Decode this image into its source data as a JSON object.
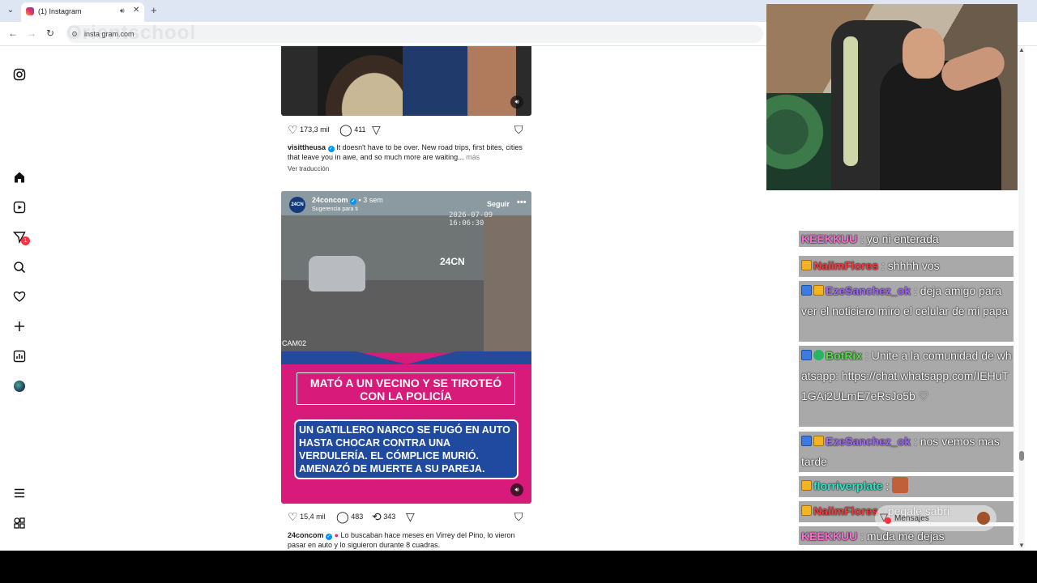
{
  "browser": {
    "tab_title": "(1) Instagram",
    "tab_dropdown_icon": "chevron-down-icon",
    "audio_icon": "speaker-icon",
    "close_icon": "close-icon",
    "new_tab_icon": "plus-icon",
    "back_icon": "arrow-left-icon",
    "forward_icon": "arrow-right-icon",
    "reload_icon": "reload-icon",
    "url": "insta gram.com",
    "watermark": "Orientschool"
  },
  "sidebar": {
    "items": [
      "instagram-logo",
      "home",
      "reels",
      "direct",
      "search",
      "notifications",
      "create",
      "dashboard",
      "profile",
      "more",
      "threads"
    ],
    "direct_badge": "1"
  },
  "post1": {
    "likes": "173,3 mil",
    "comments": "411",
    "username": "visittheusa",
    "caption": "It doesn't have to be over. New road trips, first bites, cities that leave you in awe, and so much more are waiting...",
    "more": "más",
    "translate": "Ver traducción"
  },
  "post2": {
    "avatar_text": "24CN",
    "username": "24concom",
    "time": "3 sem",
    "suggestion": "Sugerencia para ti",
    "follow": "Seguir",
    "more": "•••",
    "timestamp": "2026-07-09 16:06:30",
    "logo": "24CN",
    "cam": "CAM02",
    "headline": "MATÓ A UN VECINO Y SE TIROTEÓ CON LA POLICÍA",
    "subheadline": "UN GATILLERO NARCO SE FUGÓ EN AUTO HASTA CHOCAR CONTRA UNA VERDULERÍA. EL CÓMPLICE MURIÓ. AMENAZÓ DE MUERTE A SU PAREJA.",
    "likes": "15,4 mil",
    "comments": "483",
    "reposts": "343",
    "caption_user": "24concom",
    "caption": "Lo buscaban hace meses en Virrey del Pino, lo vieron pasar en auto y lo siguieron durante 8 cuadras."
  },
  "chat": [
    {
      "user": "KEEKKUU",
      "color": "#ff6bd6",
      "text": ": yo ni enterada",
      "badges": []
    },
    {
      "user": "NaiimFlores",
      "color": "#ff3a3a",
      "text": ": shhhh vos",
      "badges": [
        "gold"
      ]
    },
    {
      "user": "EzeSanchez_ok",
      "color": "#a366ff",
      "text": ": deja amigo para ver el noticiero miro el celular de mi papa",
      "badges": [
        "blue",
        "gold"
      ]
    },
    {
      "user": "BotRix",
      "color": "#57e04a",
      "text": ": Unite a la comunidad de whatsapp: https://chat.whatsapp.com/IEHuT1GAi2ULmE7eRsJo5b ♡",
      "badges": [
        "blue",
        "green"
      ]
    },
    {
      "user": "EzeSanchez_ok",
      "color": "#a366ff",
      "text": ": nos vemos mas tarde",
      "badges": [
        "blue",
        "gold"
      ]
    },
    {
      "user": "florriverplate",
      "color": "#2ee6c8",
      "text": ":",
      "badges": [
        "gold"
      ]
    },
    {
      "user": "NaiimFlores",
      "color": "#ff3a3a",
      "text": ": pegale sabri",
      "badges": [
        "gold"
      ]
    },
    {
      "user": "KEEKKUU",
      "color": "#ff6bd6",
      "text": ": muda me dejas",
      "badges": []
    }
  ],
  "messages_pill": {
    "label": "Mensajes"
  }
}
